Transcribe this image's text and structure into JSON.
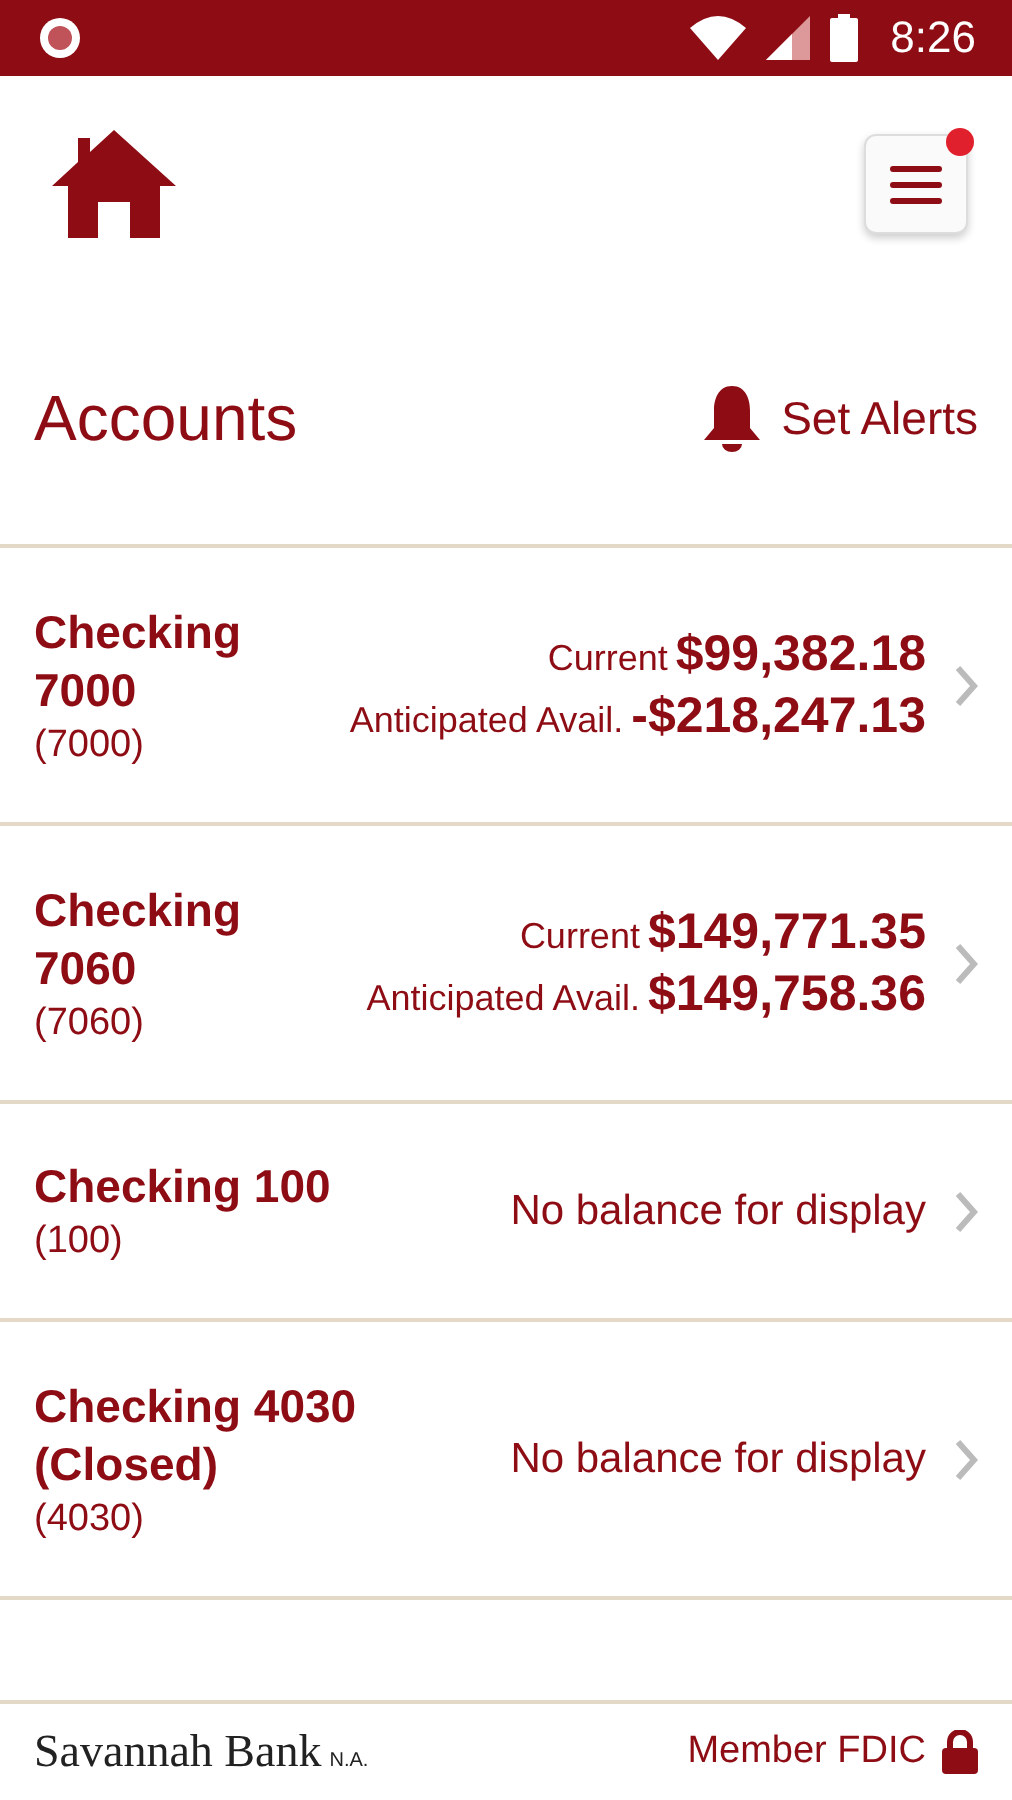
{
  "status_bar": {
    "time": "8:26"
  },
  "header": {
    "menu_notification": true
  },
  "title": "Accounts",
  "alerts_link": "Set Alerts",
  "accounts": [
    {
      "kind": "balance",
      "name": "Checking 7000",
      "number": "(7000)",
      "current_label": "Current",
      "current": "$99,382.18",
      "avail_label": "Anticipated Avail.",
      "avail": "-$218,247.13"
    },
    {
      "kind": "balance",
      "name": "Checking 7060",
      "number": "(7060)",
      "current_label": "Current",
      "current": "$149,771.35",
      "avail_label": "Anticipated Avail.",
      "avail": "$149,758.36"
    },
    {
      "kind": "none",
      "name": "Checking 100",
      "number": "(100)",
      "message": "No balance for display"
    },
    {
      "kind": "none",
      "name": "Checking 4030 (Closed)",
      "number": "(4030)",
      "message": "No balance for display"
    }
  ],
  "footer": {
    "bank": "Savannah Bank",
    "bank_suffix": "N.A.",
    "fdic": "Member FDIC"
  }
}
